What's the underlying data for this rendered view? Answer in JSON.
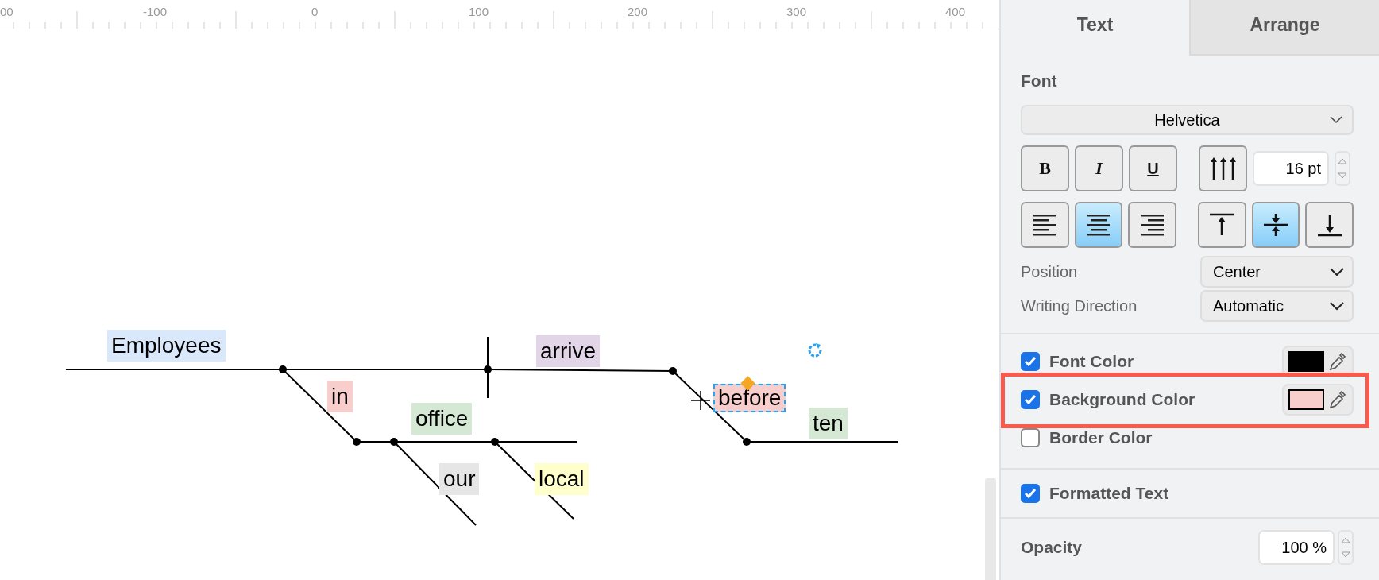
{
  "ruler": {
    "labels": [
      "00",
      "-100",
      "0",
      "100",
      "200",
      "300",
      "400"
    ]
  },
  "diagram": {
    "words": [
      {
        "text": "Employees",
        "color": "#dae8fc",
        "selected": false
      },
      {
        "text": "arrive",
        "color": "#e1d5e7",
        "selected": false
      },
      {
        "text": "in",
        "color": "#f8cecc",
        "selected": false
      },
      {
        "text": "office",
        "color": "#d5e8d4",
        "selected": false
      },
      {
        "text": "our",
        "color": "#e6e6e6",
        "selected": false
      },
      {
        "text": "local",
        "color": "#ffffcc",
        "selected": false
      },
      {
        "text": "before",
        "color": "#f8cecc",
        "selected": true
      },
      {
        "text": "ten",
        "color": "#d5e8d4",
        "selected": false
      }
    ]
  },
  "panel": {
    "tabs": [
      {
        "label": "Text",
        "selected": true
      },
      {
        "label": "Arrange",
        "selected": false
      }
    ],
    "font_heading": "Font",
    "font_family": "Helvetica",
    "style_buttons": [
      {
        "kind": "bold",
        "label": "B",
        "selected": false
      },
      {
        "kind": "italic",
        "label": "I",
        "selected": false
      },
      {
        "kind": "underline",
        "label": "U",
        "selected": false
      }
    ],
    "font_size": "16 pt",
    "align_buttons": [
      {
        "kind": "left",
        "selected": false
      },
      {
        "kind": "center",
        "selected": true
      },
      {
        "kind": "right",
        "selected": false
      }
    ],
    "valign_buttons": [
      {
        "kind": "top",
        "selected": false
      },
      {
        "kind": "middle",
        "selected": true
      },
      {
        "kind": "bottom",
        "selected": false
      }
    ],
    "position": {
      "label": "Position",
      "value": "Center"
    },
    "writing_direction": {
      "label": "Writing Direction",
      "value": "Automatic"
    },
    "color_options": [
      {
        "label": "Font Color",
        "checked": true,
        "color": "#000000",
        "highlighted": false
      },
      {
        "label": "Background Color",
        "checked": true,
        "color": "#f8cecc",
        "highlighted": true
      },
      {
        "label": "Border Color",
        "checked": false,
        "highlighted": false
      }
    ],
    "formatted_text": {
      "label": "Formatted Text",
      "checked": true
    },
    "opacity": {
      "label": "Opacity",
      "value": "100 %"
    }
  }
}
